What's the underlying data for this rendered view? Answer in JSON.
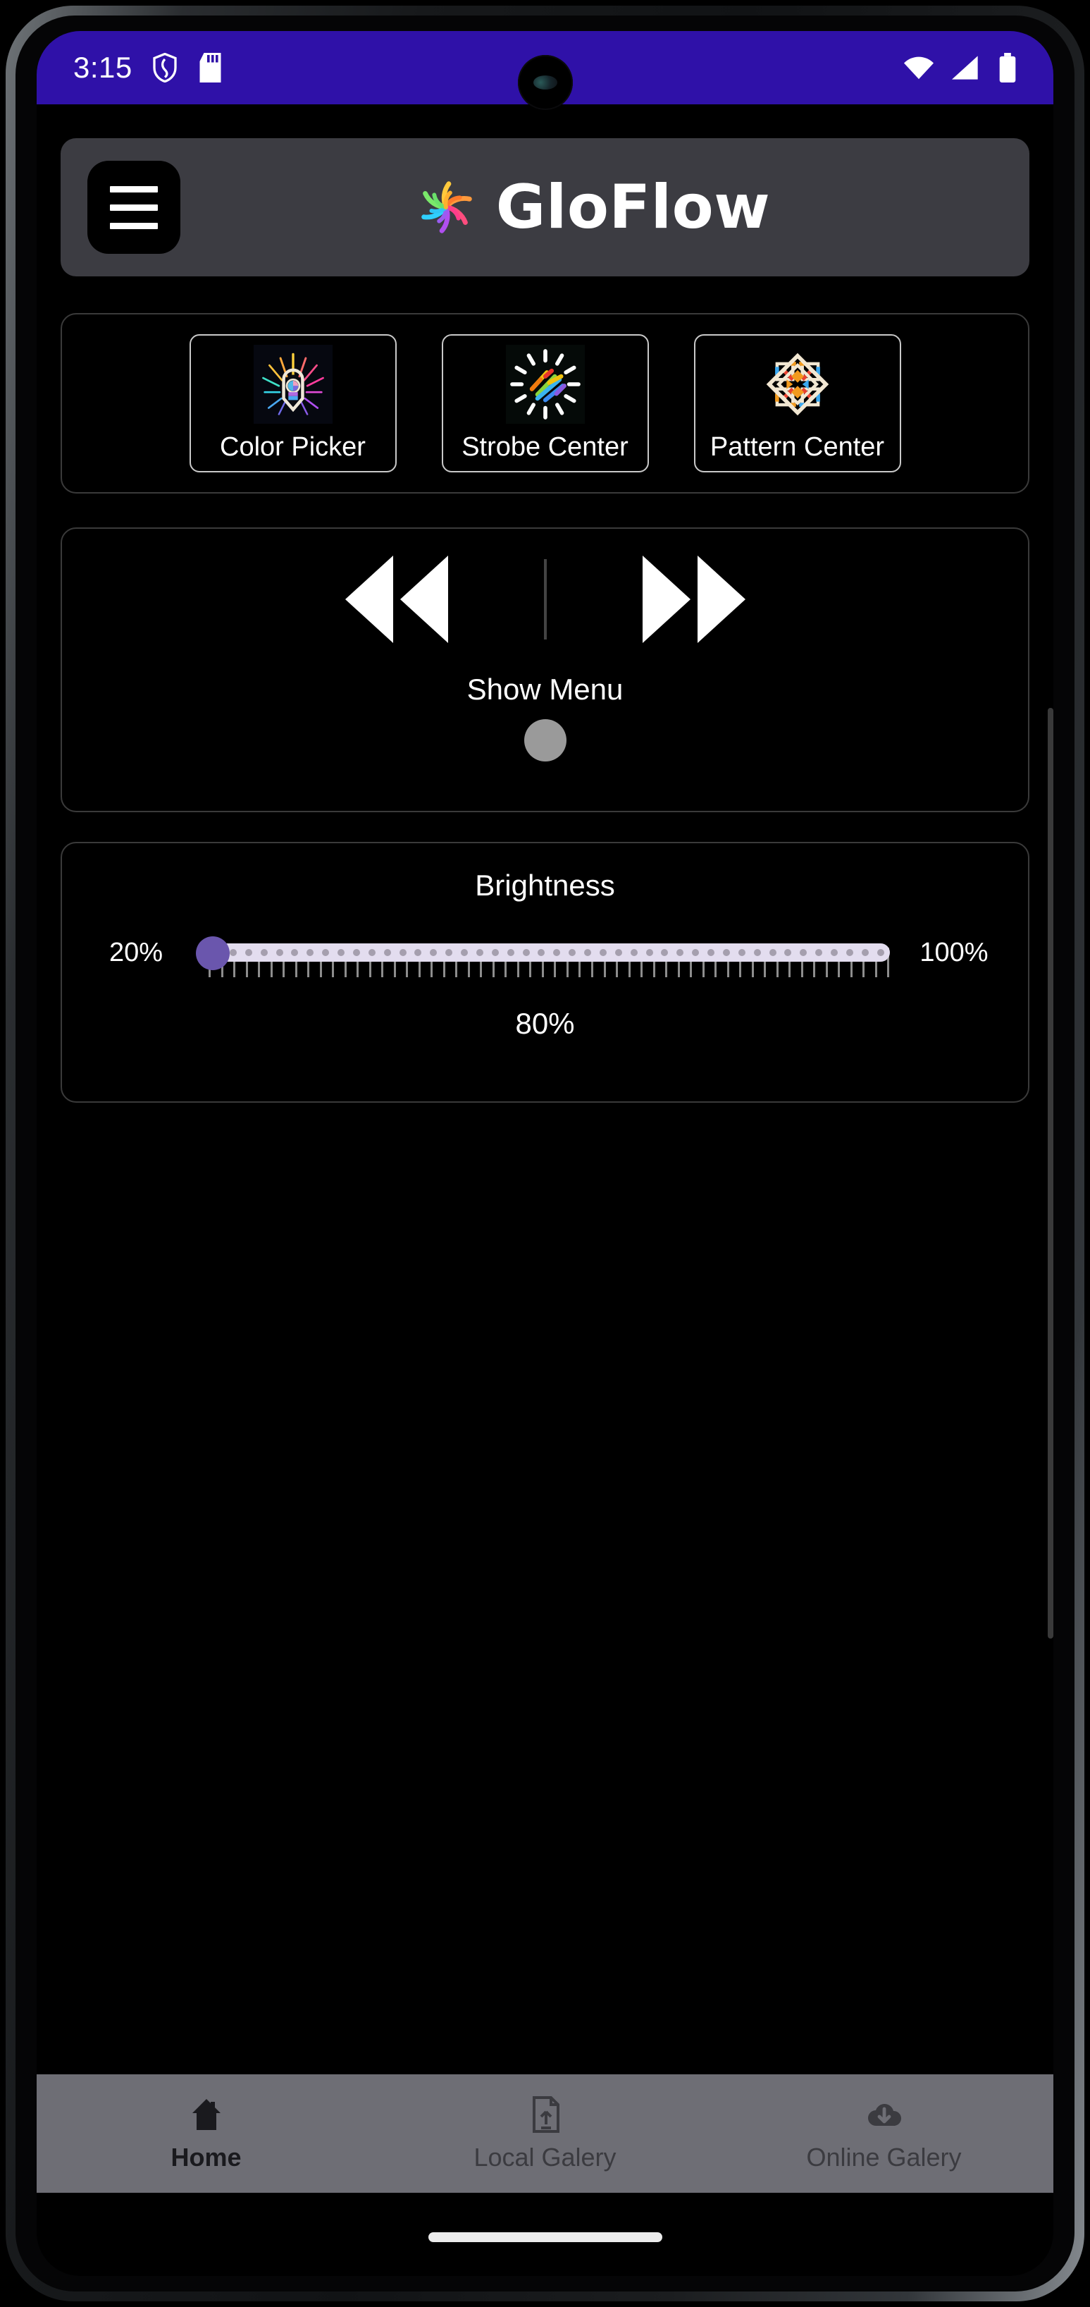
{
  "status_bar": {
    "time": "3:15",
    "left_icons": [
      "shield-icon",
      "sd-card-icon"
    ],
    "right_icons": [
      "wifi-icon",
      "cellular-signal-icon",
      "battery-icon"
    ],
    "background_color": "#2F11A8"
  },
  "header": {
    "menu_icon": "hamburger-menu-icon",
    "logo_icon": "gloflow-spiral-logo",
    "title": "GloFlow",
    "background_color": "#3C3C42"
  },
  "shortcuts": {
    "items": [
      {
        "label": "Color Picker",
        "icon": "color-picker-burst-icon"
      },
      {
        "label": "Strobe Center",
        "icon": "strobe-rays-icon"
      },
      {
        "label": "Pattern Center",
        "icon": "pattern-diamond-icon"
      }
    ]
  },
  "navigation": {
    "prev_icon": "rewind-double-left-icon",
    "next_icon": "forward-double-right-icon",
    "show_menu_label": "Show Menu",
    "toggle_icon": "circle-toggle-icon",
    "toggle_color": "#9a9a9a"
  },
  "brightness": {
    "title": "Brightness",
    "min_label": "20%",
    "max_label": "100%",
    "current_label": "80%",
    "thumb_color": "#6a56ad",
    "track_color": "#e3ddef"
  },
  "bottom_nav": {
    "items": [
      {
        "label": "Home",
        "icon": "home-icon",
        "active": true
      },
      {
        "label": "Local Galery",
        "icon": "file-upload-icon",
        "active": false
      },
      {
        "label": "Online Galery",
        "icon": "cloud-download-icon",
        "active": false
      }
    ]
  }
}
